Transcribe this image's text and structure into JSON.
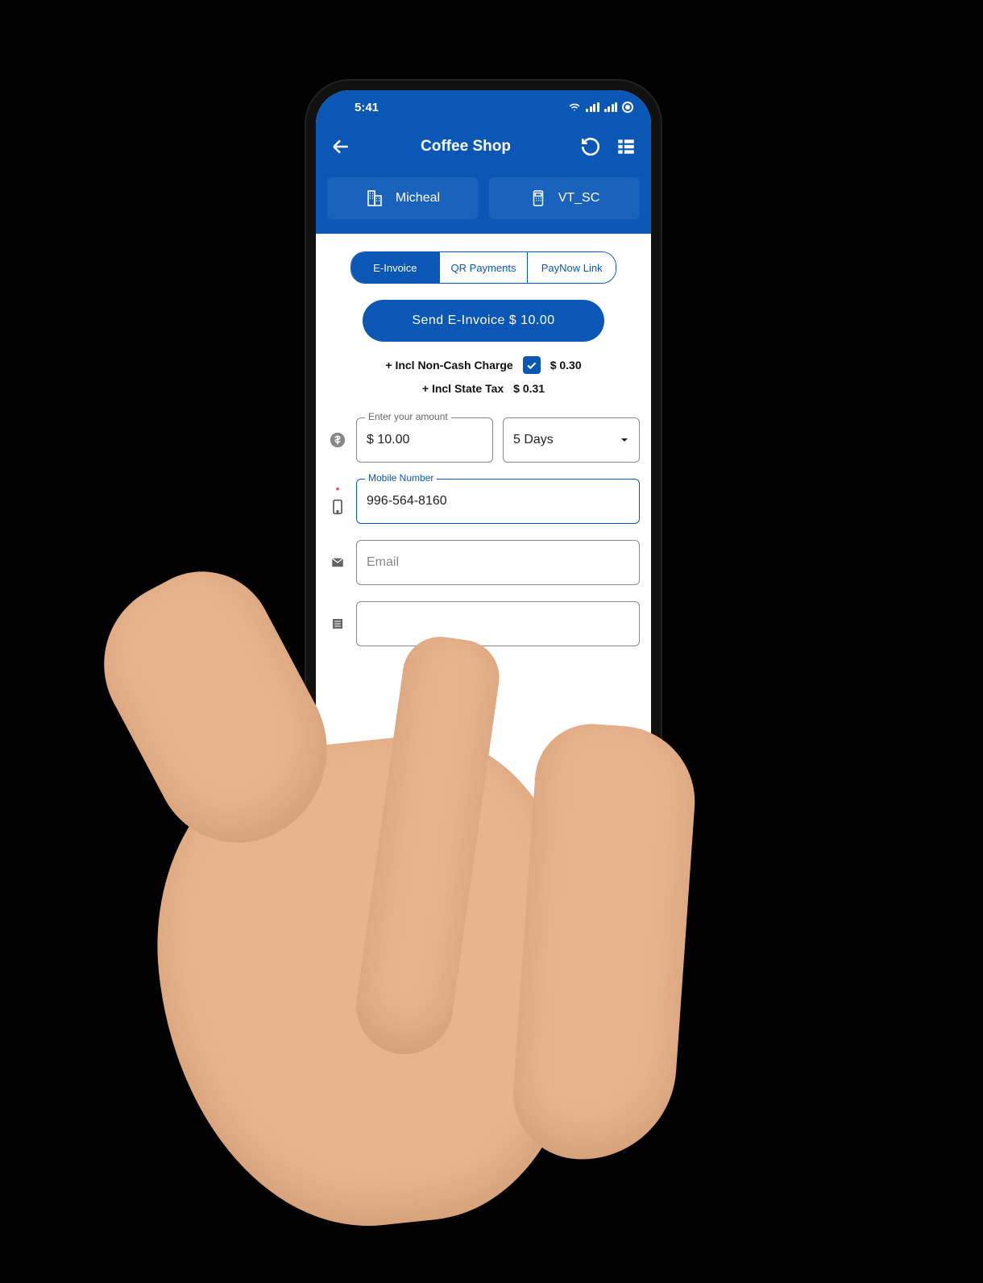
{
  "status": {
    "time": "5:41"
  },
  "header": {
    "title": "Coffee Shop"
  },
  "chips": {
    "merchant": "Micheal",
    "terminal": "VT_SC"
  },
  "tabs": {
    "items": [
      "E-Invoice",
      "QR Payments",
      "PayNow Link"
    ],
    "active": 0
  },
  "action": {
    "label": "Send E-Invoice $ 10.00"
  },
  "charges": {
    "noncash_label": "+ Incl Non-Cash Charge",
    "noncash_checked": true,
    "noncash_amount": "$ 0.30",
    "tax_label": "+ Incl  State Tax",
    "tax_amount": "$ 0.31"
  },
  "form": {
    "amount": {
      "label": "Enter your amount",
      "value": "$ 10.00"
    },
    "expiry": {
      "value": "5 Days"
    },
    "mobile": {
      "label": "Mobile Number",
      "value": "996-564-8160"
    },
    "email": {
      "placeholder": "Email"
    },
    "note": {
      "placeholder": ""
    }
  }
}
